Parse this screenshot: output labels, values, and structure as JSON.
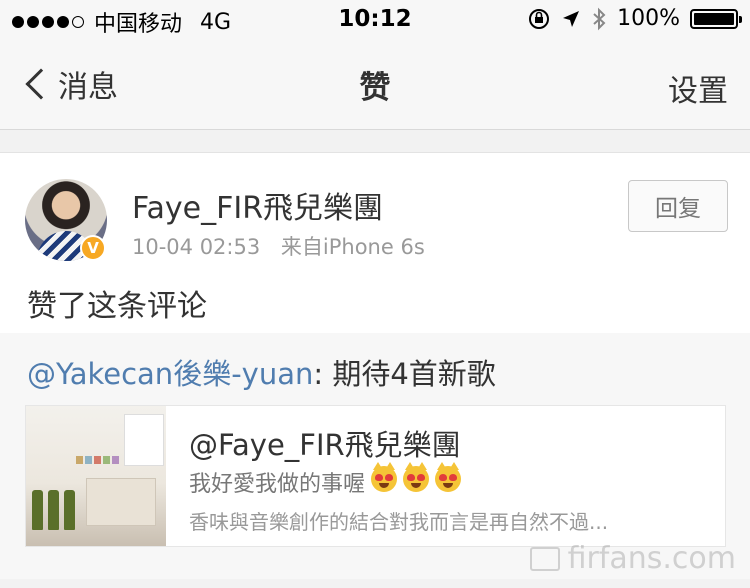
{
  "status_bar": {
    "carrier": "中国移动",
    "network": "4G",
    "time": "10:12",
    "battery": "100%",
    "battery_level": 1.0
  },
  "nav": {
    "back_label": "消息",
    "title": "赞",
    "right_label": "设置"
  },
  "notification": {
    "username": "Faye_FIR飛兒樂團",
    "date": "10-04 02:53",
    "source": "来自iPhone 6s",
    "reply_label": "回复",
    "action_text": "赞了这条评论",
    "verified_badge": "V"
  },
  "comment": {
    "mention": "@Yakecan後樂-yuan",
    "separator": ": ",
    "text": "期待4首新歌"
  },
  "shared_post": {
    "author": "@Faye_FIR飛兒樂團",
    "line1": "我好愛我做的事喔",
    "emoji_count": 3,
    "line2": "香味與音樂創作的結合對我而言是再自然不過..."
  },
  "watermark": "firfans.com",
  "colors": {
    "link": "#507daf",
    "badge": "#f7a823",
    "background": "#f2f2f2"
  }
}
